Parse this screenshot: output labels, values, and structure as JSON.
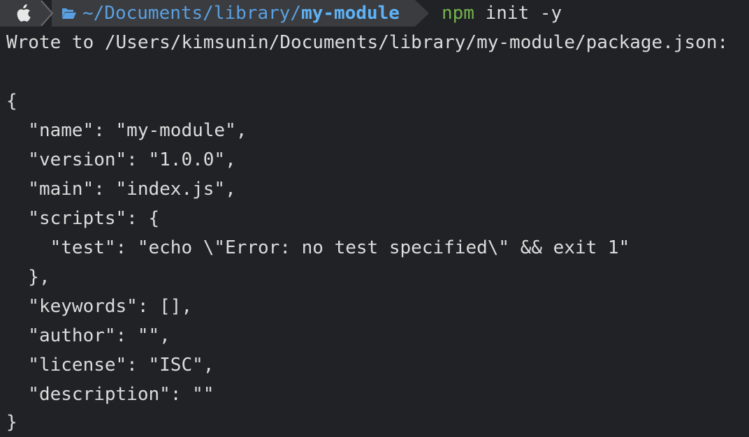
{
  "prompt": {
    "apple_icon": "apple-icon",
    "folder_icon": "folder-icon",
    "path_prefix": "~/Documents/library/",
    "path_current": "my-module",
    "command_name": "npm",
    "command_args": " init -y"
  },
  "output": {
    "wrote_line": "Wrote to /Users/kimsunin/Documents/library/my-module/package.json:",
    "json_lines": [
      "{",
      "  \"name\": \"my-module\",",
      "  \"version\": \"1.0.0\",",
      "  \"main\": \"index.js\",",
      "  \"scripts\": {",
      "    \"test\": \"echo \\\"Error: no test specified\\\" && exit 1\"",
      "  },",
      "  \"keywords\": [],",
      "  \"author\": \"\",",
      "  \"license\": \"ISC\",",
      "  \"description\": \"\"",
      "}"
    ]
  },
  "colors": {
    "background": "#212226",
    "prompt_segment": "#3a3c40",
    "path": "#5aa0e0",
    "path_current": "#5fb2f5",
    "command": "#73b44d",
    "text": "#dcdcdc"
  }
}
